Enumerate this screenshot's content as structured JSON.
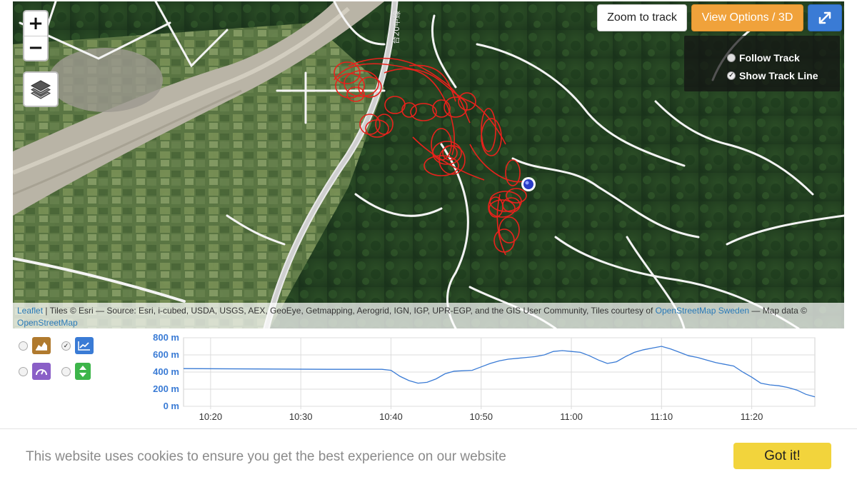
{
  "map": {
    "zoom_in_label": "+",
    "zoom_out_label": "−",
    "zoom_to_track_label": "Zoom to track",
    "view_options_label": "View Options / 3D",
    "track_options": {
      "follow_track_label": "Follow Track",
      "follow_track_checked": false,
      "show_track_line_label": "Show Track Line",
      "show_track_line_checked": true
    },
    "road_label": "台20甲線",
    "attribution": {
      "leaflet": "Leaflet",
      "sep": " | ",
      "text": "Tiles © Esri — Source: Esri, i-cubed, USDA, USGS, AEX, GeoEye, Getmapping, Aerogrid, IGN, IGP, UPR-EGP, and the GIS User Community, Tiles courtesy of ",
      "osm_sweden": "OpenStreetMap Sweden",
      "text2": " — Map data © ",
      "osm": "OpenStreetMap"
    },
    "colors": {
      "track": "#e8221c",
      "marker": "#2a3cc7",
      "accent": "#f0a23b",
      "fullscreen": "#3a7bd5"
    },
    "icons": [
      "layers-icon",
      "expand-icon"
    ]
  },
  "chart_controls": {
    "options": [
      {
        "name": "area-chart-icon",
        "selected": false,
        "color": "#b07a2e"
      },
      {
        "name": "line-chart-icon",
        "selected": true,
        "color": "#3a7bd5"
      },
      {
        "name": "speed-gauge-icon",
        "selected": false,
        "color": "#8a5fc7"
      },
      {
        "name": "vertical-speed-icon",
        "selected": false,
        "color": "#3db54a"
      }
    ]
  },
  "chart_data": {
    "type": "line",
    "title": "",
    "xlabel": "",
    "ylabel": "",
    "ylim": [
      0,
      800
    ],
    "y_ticks": [
      "0 m",
      "200 m",
      "400 m",
      "600 m",
      "800 m"
    ],
    "x_ticks": [
      "10:20",
      "10:30",
      "10:40",
      "10:50",
      "11:00",
      "11:10",
      "11:20"
    ],
    "grid": true,
    "color": "#3a7bd5",
    "series": [
      {
        "x": [
          "10:17",
          "10:25",
          "10:33",
          "10:39",
          "10:40",
          "10:41",
          "10:42",
          "10:43",
          "10:44",
          "10:45",
          "10:46",
          "10:47",
          "10:48",
          "10:49",
          "10:50",
          "10:51",
          "10:52",
          "10:53",
          "10:54",
          "10:55",
          "10:56",
          "10:57",
          "10:58",
          "10:59",
          "11:00",
          "11:01",
          "11:02",
          "11:03",
          "11:04",
          "11:05",
          "11:06",
          "11:07",
          "11:08",
          "11:09",
          "11:10",
          "11:11",
          "11:12",
          "11:13",
          "11:14",
          "11:15",
          "11:16",
          "11:17",
          "11:18",
          "11:19",
          "11:20",
          "11:21",
          "11:22",
          "11:23",
          "11:24",
          "11:25",
          "11:26",
          "11:27"
        ],
        "y": [
          440,
          436,
          432,
          432,
          420,
          350,
          300,
          270,
          280,
          320,
          380,
          410,
          415,
          420,
          460,
          500,
          530,
          550,
          560,
          570,
          580,
          600,
          640,
          650,
          640,
          630,
          590,
          540,
          500,
          520,
          580,
          630,
          660,
          680,
          700,
          670,
          630,
          590,
          570,
          540,
          510,
          490,
          470,
          400,
          340,
          270,
          250,
          240,
          220,
          190,
          140,
          110
        ]
      }
    ]
  },
  "cookie": {
    "message": "This website uses cookies to ensure you get the best experience on our website",
    "button_label": "Got it!"
  }
}
